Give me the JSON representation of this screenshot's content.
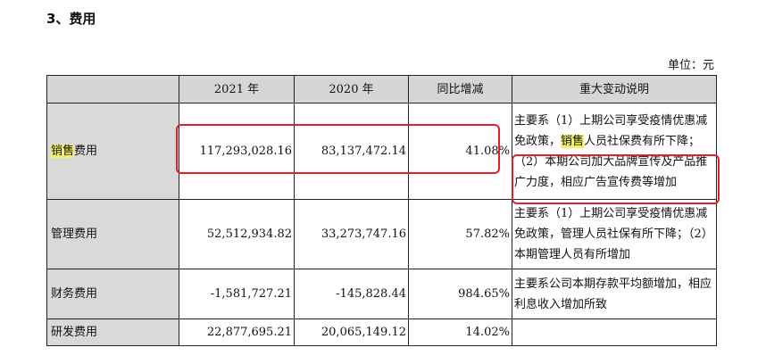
{
  "section_title": "3、费用",
  "unit": "单位：元",
  "headers": [
    "",
    "2021 年",
    "2020 年",
    "同比增减",
    "重大变动说明"
  ],
  "rows": [
    {
      "label_highlight": "销售",
      "label_rest": "费用",
      "y2021": "117,293,028.16",
      "y2020": "83,137,472.14",
      "change": "41.08%",
      "note_before": "主要系（1）上期公司享受疫情优惠减免政策，",
      "note_highlight": "销售",
      "note_after": "人员社保费有所下降；（2）本期公司加大品牌宣传及产品推广力度，相应广告宣传费等增加"
    },
    {
      "label": "管理费用",
      "y2021": "52,512,934.82",
      "y2020": "33,273,747.16",
      "change": "57.82%",
      "note": "主要系（1）上期公司享受疫情优惠减免政策，管理人员社保有所下降；（2）本期管理人员有所增加"
    },
    {
      "label": "财务费用",
      "y2021": "-1,581,727.21",
      "y2020": "-145,828.44",
      "change": "984.65%",
      "note": "主要系公司本期存款平均额增加，相应利息收入增加所致"
    },
    {
      "label": "研发费用",
      "y2021": "22,877,695.21",
      "y2020": "20,065,149.12",
      "change": "14.02%",
      "note": ""
    }
  ]
}
